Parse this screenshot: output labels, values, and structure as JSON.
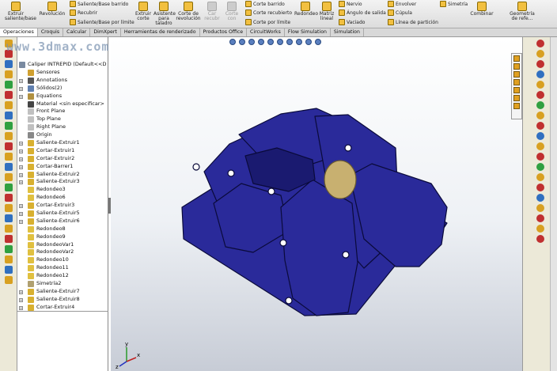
{
  "ribbon": {
    "extrude_boss_label": "Extruir saliente/base",
    "revolve_boss_label": "Revolución",
    "swept_boss_label": "Saliente/Base barrido",
    "lofted_boss_label": "Recubrir",
    "boundary_boss_label": "Saliente/Base por límite",
    "extrude_cut_label": "Extruir corte",
    "hole_wizard_label": "Asistente para taladro",
    "revolve_cut_label": "Corte de revolución",
    "lofted_cut_disabled_label": "Car recubr",
    "boundary_cut_disabled_label": "Corte con",
    "swept_cut_label": "Corte barrido",
    "lofted_cut_label": "Corte recubierto",
    "boundary_cut_label": "Corte por límite",
    "fillet_label": "Redondeo",
    "linear_pattern_label": "Matriz lineal",
    "rib_label": "Nervio",
    "draft_label": "Ángulo de salida",
    "shell_label": "Vaciado",
    "wrap_label": "Envolver",
    "dome_label": "Cúpula",
    "split_line_label": "Línea de partición",
    "mirror_label": "Simetría",
    "combine_label": "Combinar",
    "reference_geometry_label": "Geometría de refe..."
  },
  "tabs": [
    "Operaciones",
    "Croquis",
    "Calcular",
    "DimXpert",
    "Herramientas de renderizado",
    "Productos Office",
    "CircuitWorks",
    "Flow Simulation",
    "Simulation"
  ],
  "watermark": "www.3dmax.com",
  "feature_tree": {
    "root": "Caliper INTREPID  (Default<<D",
    "items": [
      {
        "label": "Sensores",
        "icon": "sensor-icon",
        "expand": false,
        "color": "#d0a030"
      },
      {
        "label": "Annotations",
        "icon": "annotations-icon",
        "expand": true,
        "color": "#555555"
      },
      {
        "label": "Sólidos(2)",
        "icon": "solid-bodies-icon",
        "expand": true,
        "color": "#6080b0"
      },
      {
        "label": "Equations",
        "icon": "equations-icon",
        "expand": true,
        "color": "#b09040"
      },
      {
        "label": "Material <sin especificar>",
        "icon": "material-icon",
        "expand": false,
        "color": "#444444"
      },
      {
        "label": "Front Plane",
        "icon": "plane-icon",
        "expand": false,
        "color": "#c0c0c0"
      },
      {
        "label": "Top Plane",
        "icon": "plane-icon",
        "expand": false,
        "color": "#c0c0c0"
      },
      {
        "label": "Right Plane",
        "icon": "plane-icon",
        "expand": false,
        "color": "#c0c0c0"
      },
      {
        "label": "Origin",
        "icon": "origin-icon",
        "expand": false,
        "color": "#888888"
      },
      {
        "label": "Saliente-Extruir1",
        "icon": "extrude-icon",
        "expand": true,
        "color": "#d8b030"
      },
      {
        "label": "Cortar-Extruir1",
        "icon": "cut-extrude-icon",
        "expand": true,
        "color": "#d8b030"
      },
      {
        "label": "Cortar-Extruir2",
        "icon": "cut-extrude-icon",
        "expand": true,
        "color": "#d8b030"
      },
      {
        "label": "Cortar-Barrer1",
        "icon": "cut-sweep-icon",
        "expand": true,
        "color": "#d8b030"
      },
      {
        "label": "Saliente-Extruir2",
        "icon": "extrude-icon",
        "expand": true,
        "color": "#d8b030"
      },
      {
        "label": "Saliente-Extruir3",
        "icon": "extrude-icon",
        "expand": true,
        "color": "#d8b030"
      },
      {
        "label": "Redondeo3",
        "icon": "fillet-icon",
        "expand": false,
        "color": "#e0c040"
      },
      {
        "label": "Redondeo6",
        "icon": "fillet-icon",
        "expand": false,
        "color": "#e0c040"
      },
      {
        "label": "Cortar-Extruir3",
        "icon": "cut-extrude-icon",
        "expand": true,
        "color": "#d8b030"
      },
      {
        "label": "Saliente-Extruir5",
        "icon": "extrude-icon",
        "expand": true,
        "color": "#d8b030"
      },
      {
        "label": "Saliente-Extruir6",
        "icon": "extrude-icon",
        "expand": true,
        "color": "#d8b030"
      },
      {
        "label": "Redondeo8",
        "icon": "fillet-icon",
        "expand": false,
        "color": "#e0c040"
      },
      {
        "label": "Redondeo9",
        "icon": "fillet-icon",
        "expand": false,
        "color": "#e0c040"
      },
      {
        "label": "RedondeoVar1",
        "icon": "fillet-icon",
        "expand": false,
        "color": "#e0c040"
      },
      {
        "label": "RedondeoVar2",
        "icon": "fillet-icon",
        "expand": false,
        "color": "#e0c040"
      },
      {
        "label": "Redondeo10",
        "icon": "fillet-icon",
        "expand": false,
        "color": "#e0c040"
      },
      {
        "label": "Redondeo11",
        "icon": "fillet-icon",
        "expand": false,
        "color": "#e0c040"
      },
      {
        "label": "Redondeo12",
        "icon": "fillet-icon",
        "expand": false,
        "color": "#e0c040"
      },
      {
        "label": "Simetría2",
        "icon": "mirror-icon",
        "expand": false,
        "color": "#b0a070"
      },
      {
        "label": "Saliente-Extruir7",
        "icon": "extrude-icon",
        "expand": true,
        "color": "#d8b030"
      },
      {
        "label": "Saliente-Extruir8",
        "icon": "extrude-icon",
        "expand": true,
        "color": "#d8b030"
      },
      {
        "label": "Cortar-Extruir4",
        "icon": "cut-extrude-icon",
        "expand": true,
        "color": "#d8b030"
      }
    ]
  },
  "model": {
    "body_color": "#2a2a9a",
    "edge_color": "#0a0a3a",
    "piston_color": "#c8b070"
  },
  "triad": {
    "x_label": "x",
    "y_label": "y",
    "z_label": "z"
  }
}
